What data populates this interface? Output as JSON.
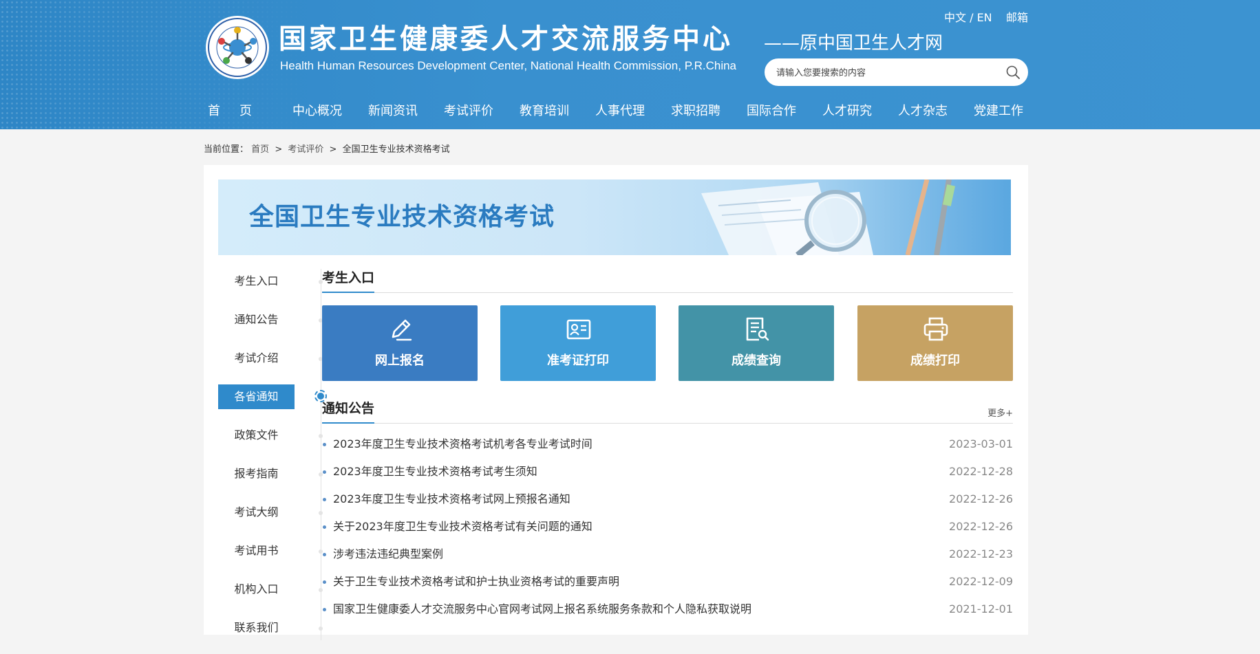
{
  "header": {
    "title_cn": "国家卫生健康委人才交流服务中心",
    "title_en": "Health Human Resources Development Center, National Health Commission, P.R.China",
    "subtitle": "——原中国卫生人才网",
    "lang_label": "中文 / EN",
    "mail_label": "邮箱",
    "search_placeholder": "请输入您要搜索的内容",
    "logo_icon": "center-logo-icon",
    "search_icon": "search-icon"
  },
  "nav": {
    "items": [
      "首页",
      "中心概况",
      "新闻资讯",
      "考试评价",
      "教育培训",
      "人事代理",
      "求职招聘",
      "国际合作",
      "人才研究",
      "人才杂志",
      "党建工作"
    ]
  },
  "breadcrumb": {
    "prefix": "当前位置：",
    "items": [
      "首页",
      "考试评价",
      "全国卫生专业技术资格考试"
    ],
    "separator": ">"
  },
  "banner": {
    "title": "全国卫生专业技术资格考试"
  },
  "sidebar": {
    "items": [
      "考生入口",
      "通知公告",
      "考试介绍",
      "各省通知",
      "政策文件",
      "报考指南",
      "考试大纲",
      "考试用书",
      "机构入口",
      "联系我们"
    ],
    "active": "各省通知"
  },
  "entrance": {
    "title": "考生入口",
    "tiles": [
      {
        "label": "网上报名",
        "icon": "pen-edit-icon",
        "color": "#3a7cc2"
      },
      {
        "label": "准考证打印",
        "icon": "id-card-icon",
        "color": "#409ed9"
      },
      {
        "label": "成绩查询",
        "icon": "document-search-icon",
        "color": "#4393a7"
      },
      {
        "label": "成绩打印",
        "icon": "printer-icon",
        "color": "#c6a263"
      }
    ]
  },
  "notices": {
    "title": "通知公告",
    "more_label": "更多+",
    "items": [
      {
        "title": "2023年度卫生专业技术资格考试机考各专业考试时间",
        "date": "2023-03-01"
      },
      {
        "title": "2023年度卫生专业技术资格考试考生须知",
        "date": "2022-12-28"
      },
      {
        "title": "2023年度卫生专业技术资格考试网上预报名通知",
        "date": "2022-12-26"
      },
      {
        "title": "关于2023年度卫生专业技术资格考试有关问题的通知",
        "date": "2022-12-26"
      },
      {
        "title": "涉考违法违纪典型案例",
        "date": "2022-12-23"
      },
      {
        "title": "关于卫生专业技术资格考试和护士执业资格考试的重要声明",
        "date": "2022-12-09"
      },
      {
        "title": "国家卫生健康委人才交流服务中心官网考试网上报名系统服务条款和个人隐私获取说明",
        "date": "2021-12-01"
      }
    ]
  }
}
